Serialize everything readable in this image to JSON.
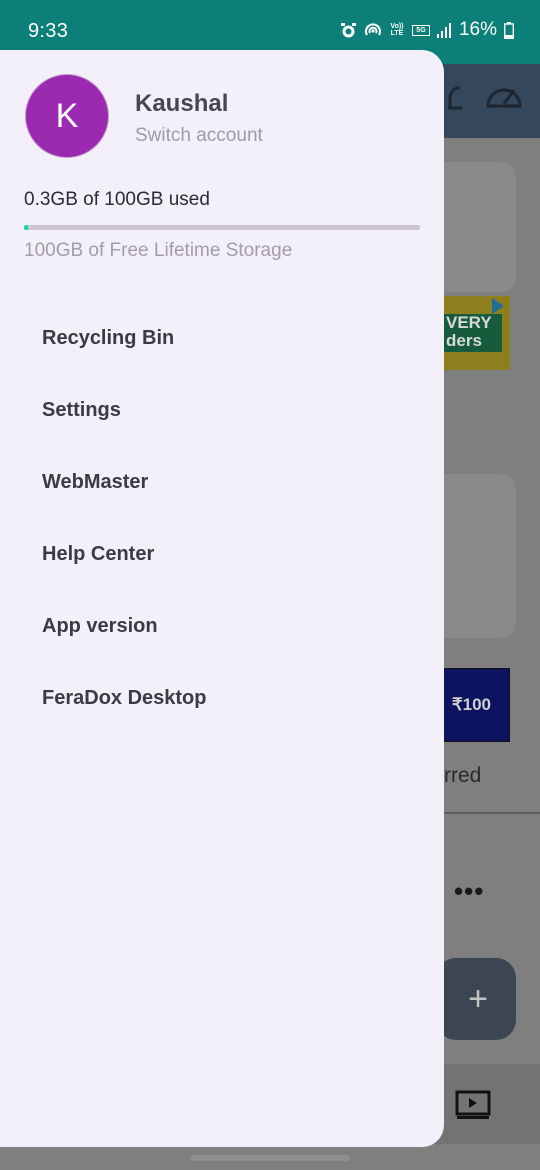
{
  "status_bar": {
    "time": "9:33",
    "battery": "16%",
    "network_labels": [
      "Vo)) LTE",
      "5G"
    ],
    "icons": [
      "alarm-icon",
      "hotspot-icon",
      "volte-icon",
      "5g-icon",
      "signal-icon",
      "battery-icon"
    ]
  },
  "account": {
    "avatar_letter": "K",
    "name": "Kaushal",
    "switch_label": "Switch account"
  },
  "storage": {
    "used_label": "0.3GB of 100GB used",
    "used_fraction": 0.003,
    "note": "100GB of Free Lifetime Storage"
  },
  "menu": [
    {
      "label": "Recycling Bin"
    },
    {
      "label": "Settings"
    },
    {
      "label": "WebMaster"
    },
    {
      "label": "Help Center"
    },
    {
      "label": "App version"
    },
    {
      "label": "FeraDox Desktop"
    }
  ],
  "background": {
    "banner1_text": "VERY ders",
    "banner2_text": "₹100",
    "section_text": "rred",
    "more_text": "•••",
    "fab_text": "+"
  },
  "colors": {
    "status_bar": "#0b7f78",
    "drawer_bg": "#f4f0fa",
    "avatar": "#9b2ab0",
    "progress_fill": "#1fd2a8",
    "progress_track": "#cbc6d0"
  }
}
